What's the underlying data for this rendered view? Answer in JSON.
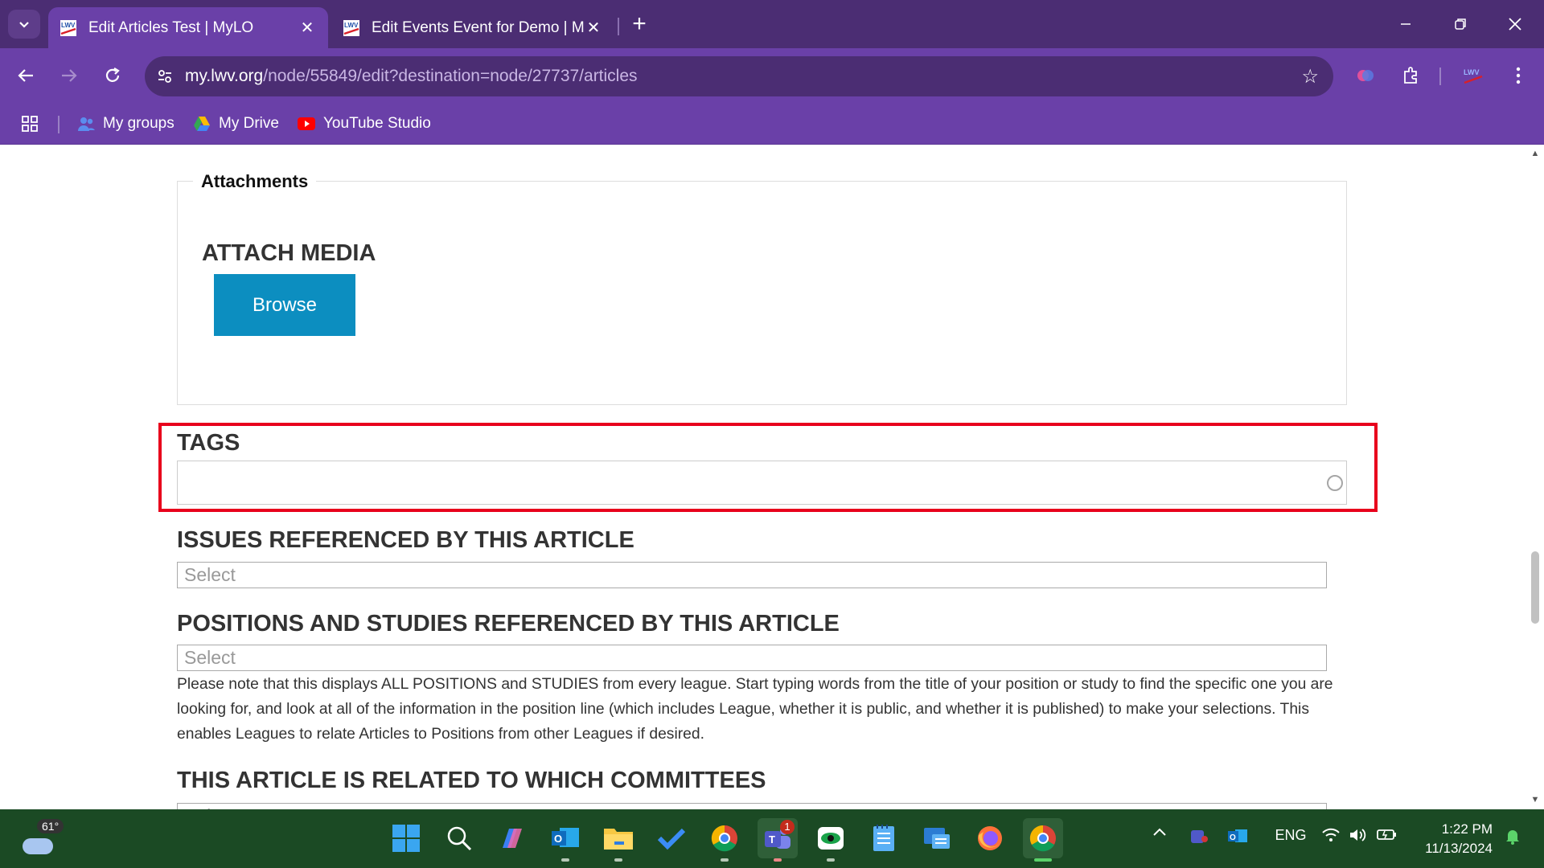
{
  "browser": {
    "tabs": [
      {
        "title": "Edit Articles Test | MyLO",
        "active": true
      },
      {
        "title": "Edit Events Event for Demo | My",
        "active": false
      }
    ],
    "url": {
      "host": "my.lwv.org",
      "path": "/node/55849/edit?destination=node/27737/articles"
    },
    "bookmarks": [
      {
        "label": "My groups",
        "icon": "groups-icon"
      },
      {
        "label": "My Drive",
        "icon": "google-drive-icon"
      },
      {
        "label": "YouTube Studio",
        "icon": "youtube-studio-icon"
      }
    ],
    "theme": {
      "tabbar": "#4b2d73",
      "toolbar": "#6a40a8"
    }
  },
  "page": {
    "attachments": {
      "legend": "Attachments",
      "attach_media_label": "ATTACH MEDIA",
      "browse_label": "Browse"
    },
    "tags": {
      "label": "TAGS",
      "value": ""
    },
    "issues": {
      "label": "ISSUES REFERENCED BY THIS ARTICLE",
      "placeholder": "Select"
    },
    "positions": {
      "label": "POSITIONS AND STUDIES REFERENCED BY THIS ARTICLE",
      "placeholder": "Select",
      "help": "Please note that this displays ALL POSITIONS and STUDIES from every league. Start typing words from the title of your position or study to find the specific one you are looking for, and look at all of the information in the position line (which includes League, whether it is public, and whether it is published) to make your selections. This enables Leagues to relate Articles to Positions from other Leagues if desired."
    },
    "committees": {
      "label": "THIS ARTICLE IS RELATED TO WHICH COMMITTEES",
      "placeholder": "Select"
    },
    "colors": {
      "accent": "#0c8ec0",
      "highlight": "#e8001c"
    }
  },
  "taskbar": {
    "weather_temp": "61°",
    "language": "ENG",
    "time": "1:22 PM",
    "date": "11/13/2024",
    "teams_badge": "1",
    "colors": {
      "background": "#1b4a24"
    }
  }
}
